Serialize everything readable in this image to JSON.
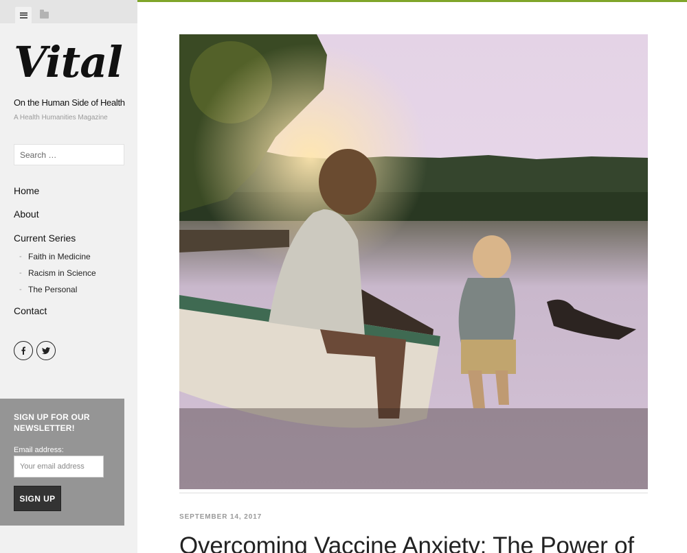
{
  "sidebar": {
    "tabs": [
      {
        "icon": "menu-icon",
        "active": true
      },
      {
        "icon": "folder-icon",
        "active": false
      }
    ],
    "logo": "Vital",
    "tagline": "On the Human Side of Health",
    "subtag": "A Health Humanities Magazine",
    "search": {
      "placeholder": "Search …"
    },
    "nav": {
      "home": "Home",
      "about": "About",
      "current_series": "Current Series",
      "series_items": [
        "Faith in Medicine",
        "Racism in Science",
        "The Personal"
      ],
      "contact": "Contact"
    },
    "social": [
      "facebook-icon",
      "twitter-icon"
    ],
    "newsletter": {
      "title": "SIGN UP FOR OUR NEWSLETTER!",
      "email_label": "Email address:",
      "email_placeholder": "Your email address",
      "button": "SIGN UP"
    }
  },
  "post": {
    "date": "SEPTEMBER 14, 2017",
    "title": "Overcoming Vaccine Anxiety: The Power of"
  },
  "colors": {
    "accent": "#7fa52a",
    "sidebar_bg": "#f1f1f1",
    "newsletter_bg": "#959595"
  }
}
